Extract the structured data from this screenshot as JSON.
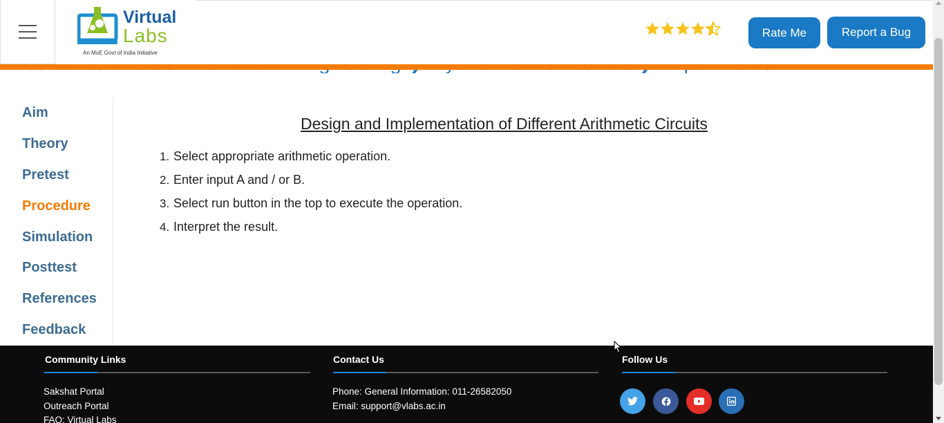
{
  "header": {
    "breadcrumb": [
      "Electronics and Communication Engineering",
      "Hybrid Electronics Lab",
      "Experiments"
    ],
    "breadcrumb_separator": "❯",
    "logo": {
      "brand_top": "Virtual",
      "brand_bottom": "Labs",
      "tagline": "An MoE Govt of India Initiative"
    },
    "rating": {
      "value": 4.5,
      "max": 5,
      "color": "#f7c31a"
    },
    "rate_button": "Rate Me",
    "bug_button": "Report a Bug"
  },
  "sidebar": {
    "items": [
      {
        "label": "Aim",
        "active": false
      },
      {
        "label": "Theory",
        "active": false
      },
      {
        "label": "Pretest",
        "active": false
      },
      {
        "label": "Procedure",
        "active": true
      },
      {
        "label": "Simulation",
        "active": false
      },
      {
        "label": "Posttest",
        "active": false
      },
      {
        "label": "References",
        "active": false
      },
      {
        "label": "Feedback",
        "active": false
      }
    ]
  },
  "main": {
    "title": "Design and Implementation of Different Arithmetic Circuits",
    "steps": [
      {
        "num": "1.",
        "text": "Select appropriate arithmetic operation."
      },
      {
        "num": "2.",
        "text": "Enter input A and / or B."
      },
      {
        "num": "3.",
        "text": "Select run button in the top to execute the operation."
      },
      {
        "num": "4.",
        "text": "Interpret the result."
      }
    ]
  },
  "footer": {
    "community": {
      "title": "Community Links",
      "links": [
        "Sakshat Portal",
        "Outreach Portal",
        "FAQ: Virtual Labs"
      ]
    },
    "contact": {
      "title": "Contact Us",
      "phone": "Phone: General Information: 011-26582050",
      "email": "Email: support@vlabs.ac.in"
    },
    "follow": {
      "title": "Follow Us",
      "icons": [
        "twitter-icon",
        "facebook-icon",
        "youtube-icon",
        "linkedin-icon"
      ]
    }
  },
  "colors": {
    "accent_orange": "#f57c00",
    "button_blue": "#1a7ac5",
    "link_blue": "#3d6b94"
  }
}
